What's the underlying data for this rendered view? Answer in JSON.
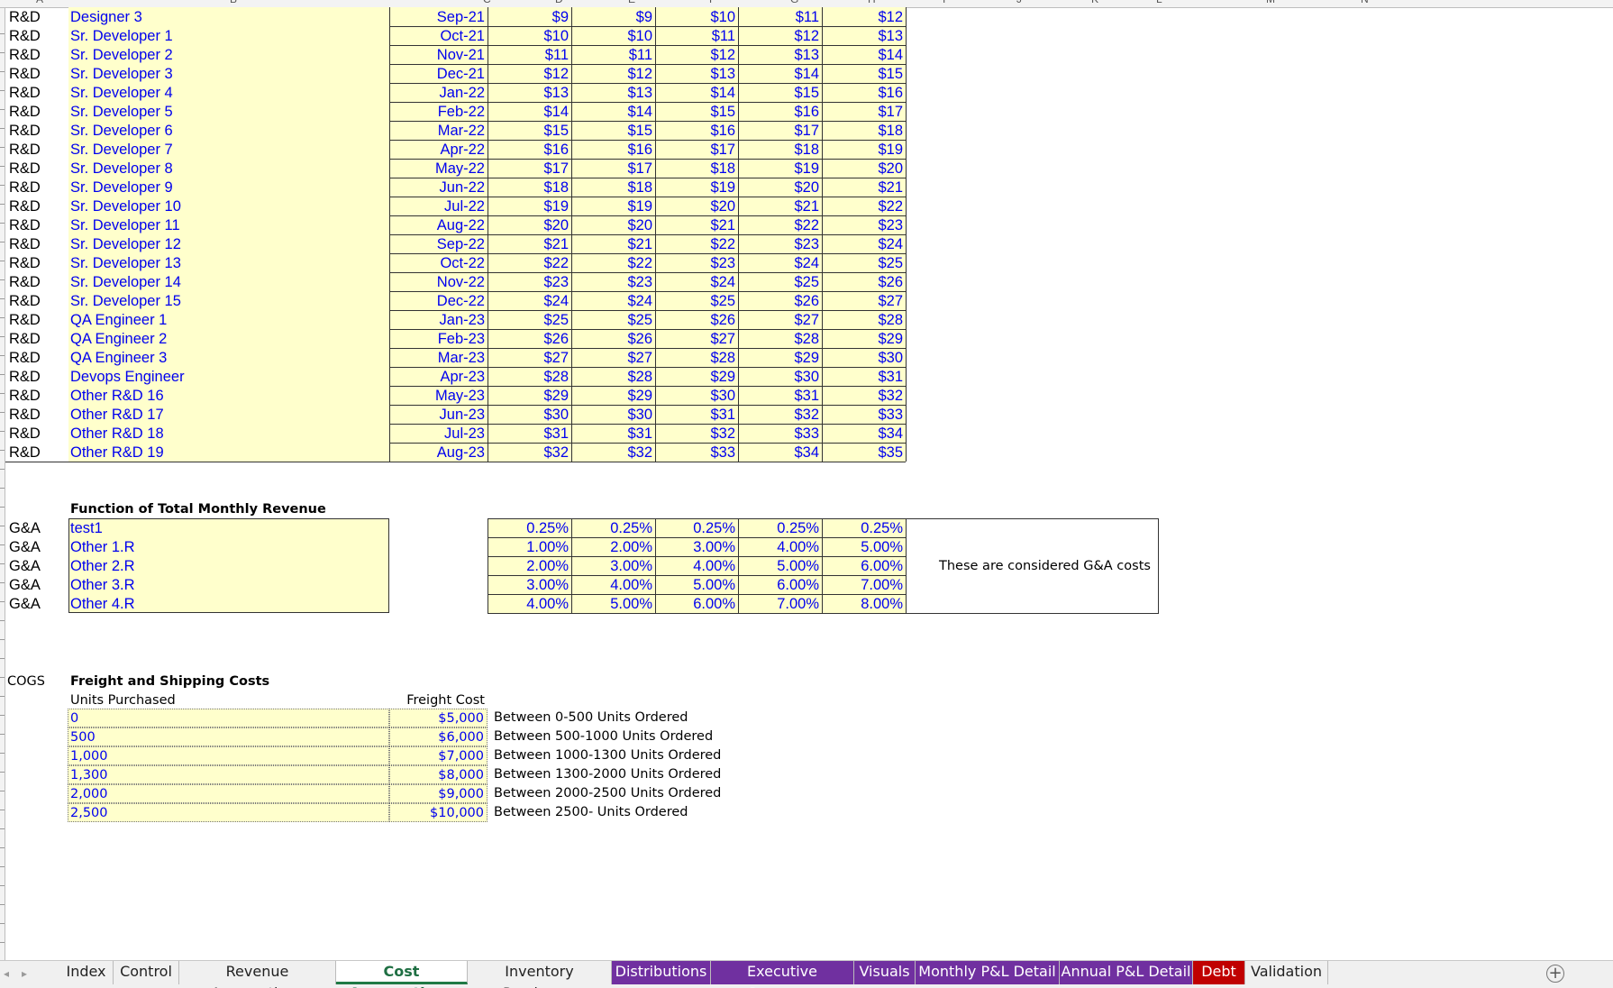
{
  "tabs": [
    {
      "label": "Index",
      "style": "normal"
    },
    {
      "label": "Control",
      "style": "normal"
    },
    {
      "label": "Revenue Assumptions",
      "style": "normal"
    },
    {
      "label": "Cost Assumptions",
      "style": "active"
    },
    {
      "label": "Inventory Purchases",
      "style": "normal"
    },
    {
      "label": "Distributions",
      "style": "purple"
    },
    {
      "label": "Executive Summary",
      "style": "purple"
    },
    {
      "label": "Visuals",
      "style": "purple"
    },
    {
      "label": "Monthly P&L Detail",
      "style": "purple"
    },
    {
      "label": "Annual P&L Detail",
      "style": "purple"
    },
    {
      "label": "Debt",
      "style": "red"
    },
    {
      "label": "Validation",
      "style": "normal"
    }
  ],
  "tab_colors": {
    "purple": "#7030a0",
    "red": "#c00000",
    "active": "#1f7a45"
  },
  "col_headers": [
    "A",
    "B",
    "C",
    "D",
    "E",
    "F",
    "G",
    "H",
    "I",
    "J",
    "K",
    "L",
    "M",
    "N"
  ],
  "rd_rows": [
    {
      "dept": "R&D",
      "role": "Designer 3",
      "start": "Sep-21",
      "v": [
        "$9",
        "$9",
        "$10",
        "$11",
        "$12"
      ]
    },
    {
      "dept": "R&D",
      "role": "Sr. Developer 1",
      "start": "Oct-21",
      "v": [
        "$10",
        "$10",
        "$11",
        "$12",
        "$13"
      ]
    },
    {
      "dept": "R&D",
      "role": "Sr. Developer 2",
      "start": "Nov-21",
      "v": [
        "$11",
        "$11",
        "$12",
        "$13",
        "$14"
      ]
    },
    {
      "dept": "R&D",
      "role": "Sr. Developer 3",
      "start": "Dec-21",
      "v": [
        "$12",
        "$12",
        "$13",
        "$14",
        "$15"
      ]
    },
    {
      "dept": "R&D",
      "role": "Sr. Developer 4",
      "start": "Jan-22",
      "v": [
        "$13",
        "$13",
        "$14",
        "$15",
        "$16"
      ]
    },
    {
      "dept": "R&D",
      "role": "Sr. Developer 5",
      "start": "Feb-22",
      "v": [
        "$14",
        "$14",
        "$15",
        "$16",
        "$17"
      ]
    },
    {
      "dept": "R&D",
      "role": "Sr. Developer 6",
      "start": "Mar-22",
      "v": [
        "$15",
        "$15",
        "$16",
        "$17",
        "$18"
      ]
    },
    {
      "dept": "R&D",
      "role": "Sr. Developer 7",
      "start": "Apr-22",
      "v": [
        "$16",
        "$16",
        "$17",
        "$18",
        "$19"
      ]
    },
    {
      "dept": "R&D",
      "role": "Sr. Developer 8",
      "start": "May-22",
      "v": [
        "$17",
        "$17",
        "$18",
        "$19",
        "$20"
      ]
    },
    {
      "dept": "R&D",
      "role": "Sr. Developer 9",
      "start": "Jun-22",
      "v": [
        "$18",
        "$18",
        "$19",
        "$20",
        "$21"
      ]
    },
    {
      "dept": "R&D",
      "role": "Sr. Developer 10",
      "start": "Jul-22",
      "v": [
        "$19",
        "$19",
        "$20",
        "$21",
        "$22"
      ]
    },
    {
      "dept": "R&D",
      "role": "Sr. Developer 11",
      "start": "Aug-22",
      "v": [
        "$20",
        "$20",
        "$21",
        "$22",
        "$23"
      ]
    },
    {
      "dept": "R&D",
      "role": "Sr. Developer 12",
      "start": "Sep-22",
      "v": [
        "$21",
        "$21",
        "$22",
        "$23",
        "$24"
      ]
    },
    {
      "dept": "R&D",
      "role": "Sr. Developer 13",
      "start": "Oct-22",
      "v": [
        "$22",
        "$22",
        "$23",
        "$24",
        "$25"
      ]
    },
    {
      "dept": "R&D",
      "role": "Sr. Developer 14",
      "start": "Nov-22",
      "v": [
        "$23",
        "$23",
        "$24",
        "$25",
        "$26"
      ]
    },
    {
      "dept": "R&D",
      "role": "Sr. Developer 15",
      "start": "Dec-22",
      "v": [
        "$24",
        "$24",
        "$25",
        "$26",
        "$27"
      ]
    },
    {
      "dept": "R&D",
      "role": "QA Engineer 1",
      "start": "Jan-23",
      "v": [
        "$25",
        "$25",
        "$26",
        "$27",
        "$28"
      ]
    },
    {
      "dept": "R&D",
      "role": "QA Engineer 2",
      "start": "Feb-23",
      "v": [
        "$26",
        "$26",
        "$27",
        "$28",
        "$29"
      ]
    },
    {
      "dept": "R&D",
      "role": "QA Engineer 3",
      "start": "Mar-23",
      "v": [
        "$27",
        "$27",
        "$28",
        "$29",
        "$30"
      ]
    },
    {
      "dept": "R&D",
      "role": "Devops Engineer",
      "start": "Apr-23",
      "v": [
        "$28",
        "$28",
        "$29",
        "$30",
        "$31"
      ]
    },
    {
      "dept": "R&D",
      "role": "Other R&D 16",
      "start": "May-23",
      "v": [
        "$29",
        "$29",
        "$30",
        "$31",
        "$32"
      ]
    },
    {
      "dept": "R&D",
      "role": "Other R&D 17",
      "start": "Jun-23",
      "v": [
        "$30",
        "$30",
        "$31",
        "$32",
        "$33"
      ]
    },
    {
      "dept": "R&D",
      "role": "Other R&D 18",
      "start": "Jul-23",
      "v": [
        "$31",
        "$31",
        "$32",
        "$33",
        "$34"
      ]
    },
    {
      "dept": "R&D",
      "role": "Other R&D 19",
      "start": "Aug-23",
      "v": [
        "$32",
        "$32",
        "$33",
        "$34",
        "$35"
      ]
    }
  ],
  "ga_section": {
    "title": "Function of Total Monthly Revenue",
    "note": "These are considered G&A costs",
    "rows": [
      {
        "dept": "G&A",
        "name": "test1",
        "v": [
          "0.25%",
          "0.25%",
          "0.25%",
          "0.25%",
          "0.25%"
        ]
      },
      {
        "dept": "G&A",
        "name": "Other 1.R",
        "v": [
          "1.00%",
          "2.00%",
          "3.00%",
          "4.00%",
          "5.00%"
        ]
      },
      {
        "dept": "G&A",
        "name": "Other 2.R",
        "v": [
          "2.00%",
          "3.00%",
          "4.00%",
          "5.00%",
          "6.00%"
        ]
      },
      {
        "dept": "G&A",
        "name": "Other 3.R",
        "v": [
          "3.00%",
          "4.00%",
          "5.00%",
          "6.00%",
          "7.00%"
        ]
      },
      {
        "dept": "G&A",
        "name": "Other 4.R",
        "v": [
          "4.00%",
          "5.00%",
          "6.00%",
          "7.00%",
          "8.00%"
        ]
      }
    ]
  },
  "cogs_section": {
    "dept": "COGS",
    "title": "Freight and Shipping Costs",
    "units_header": "Units Purchased",
    "cost_header": "Freight Cost",
    "rows": [
      {
        "units": "0",
        "cost": "$5,000",
        "desc": "Between 0-500 Units Ordered"
      },
      {
        "units": "500",
        "cost": "$6,000",
        "desc": "Between 500-1000 Units Ordered"
      },
      {
        "units": "1,000",
        "cost": "$7,000",
        "desc": "Between 1000-1300 Units Ordered"
      },
      {
        "units": "1,300",
        "cost": "$8,000",
        "desc": "Between 1300-2000 Units Ordered"
      },
      {
        "units": "2,000",
        "cost": "$9,000",
        "desc": "Between 2000-2500 Units Ordered"
      },
      {
        "units": "2,500",
        "cost": "$10,000",
        "desc": "Between 2500- Units Ordered"
      }
    ]
  }
}
